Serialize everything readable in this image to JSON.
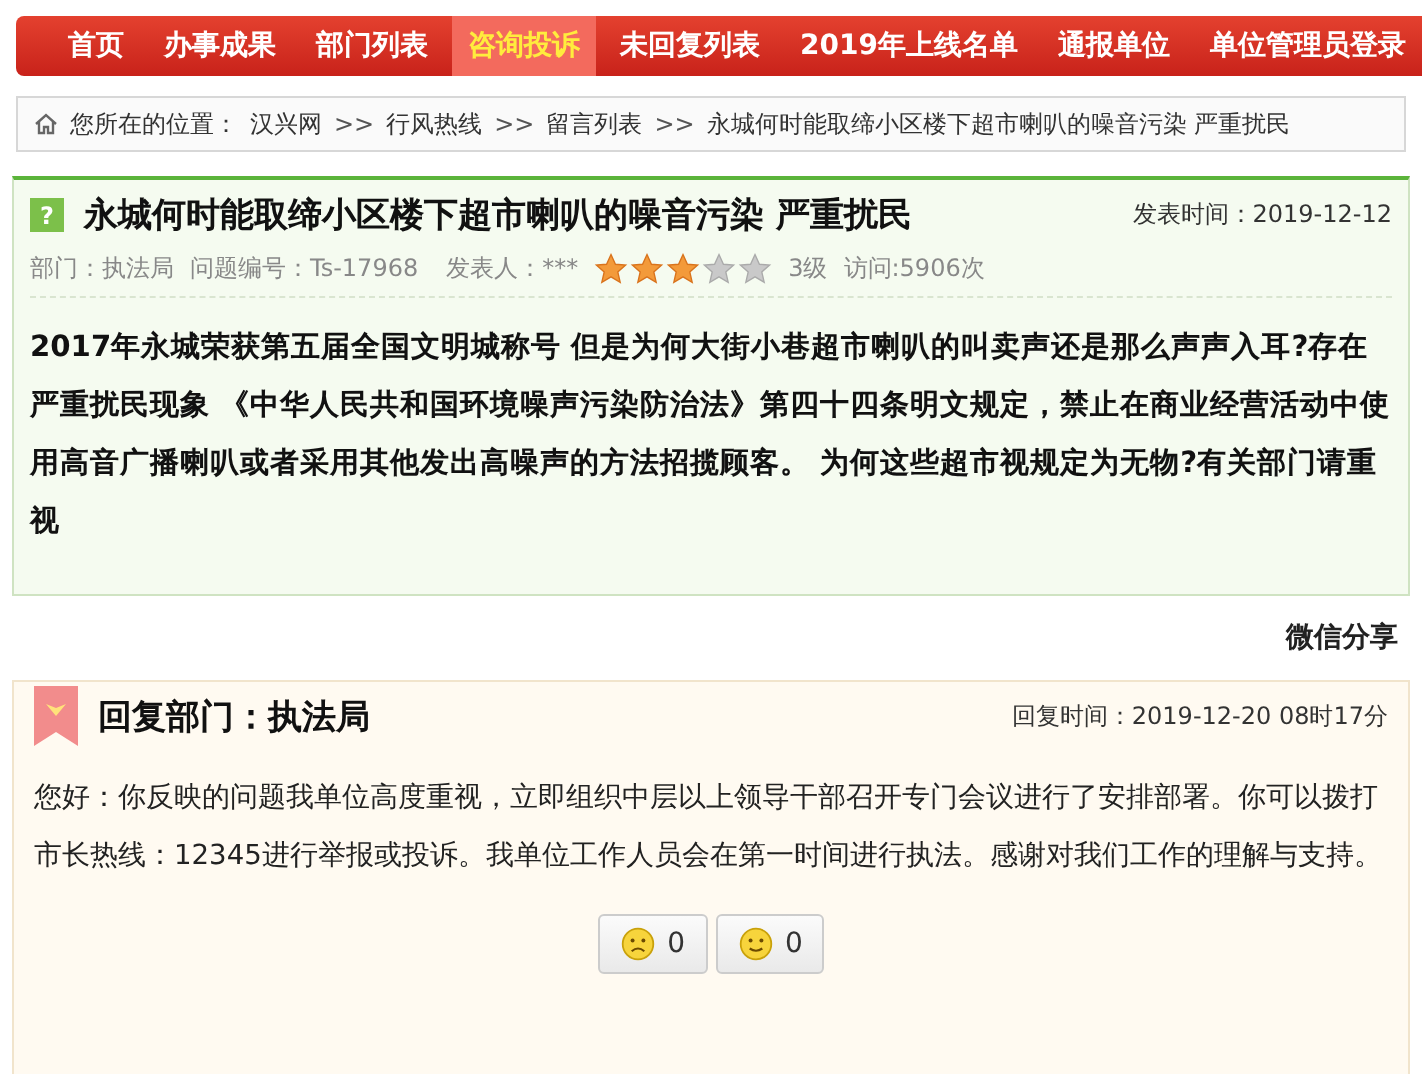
{
  "nav": [
    {
      "label": "首页",
      "selected": false
    },
    {
      "label": "办事成果",
      "selected": false
    },
    {
      "label": "部门列表",
      "selected": false
    },
    {
      "label": "咨询投诉",
      "selected": true
    },
    {
      "label": "未回复列表",
      "selected": false
    },
    {
      "label": "2019年上线名单",
      "selected": false
    },
    {
      "label": "通报单位",
      "selected": false
    },
    {
      "label": "单位管理员登录",
      "selected": false
    }
  ],
  "breadcrumb": {
    "prefix": "您所在的位置：",
    "items": [
      "汉兴网",
      "行风热线",
      "留言列表",
      "永城何时能取缔小区楼下超市喇叭的噪音污染 严重扰民"
    ],
    "separator": ">>"
  },
  "question": {
    "badge": "?",
    "title": "永城何时能取缔小区楼下超市喇叭的噪音污染 严重扰民",
    "date_label": "发表时间：2019-12-12",
    "department": "部门：执法局",
    "number": "问题编号：Ts-17968",
    "author": "发表人：***",
    "stars": 3,
    "level_text": "3级",
    "visits": "访问:5906次",
    "body": "2017年永城荣获第五届全国文明城称号 但是为何大街小巷超市喇叭的叫卖声还是那么声声入耳?存在严重扰民现象 《中华人民共和国环境噪声污染防治法》第四十四条明文规定，禁止在商业经营活动中使用高音广播喇叭或者采用其他发出高噪声的方法招揽顾客。 为何这些超市视规定为无物?有关部门请重视"
  },
  "share": "微信分享",
  "reply": {
    "title": "回复部门：执法局",
    "time": "回复时间：2019-12-20 08时17分",
    "body": "您好：你反映的问题我单位高度重视，立即组织中层以上领导干部召开专门会议进行了安排部署。你可以拨打市长热线：12345进行举报或投诉。我单位工作人员会在第一时间进行执法。感谢对我们工作的理解与支持。",
    "votes": [
      {
        "kind": "sad",
        "count": "0"
      },
      {
        "kind": "smile",
        "count": "0"
      }
    ]
  }
}
